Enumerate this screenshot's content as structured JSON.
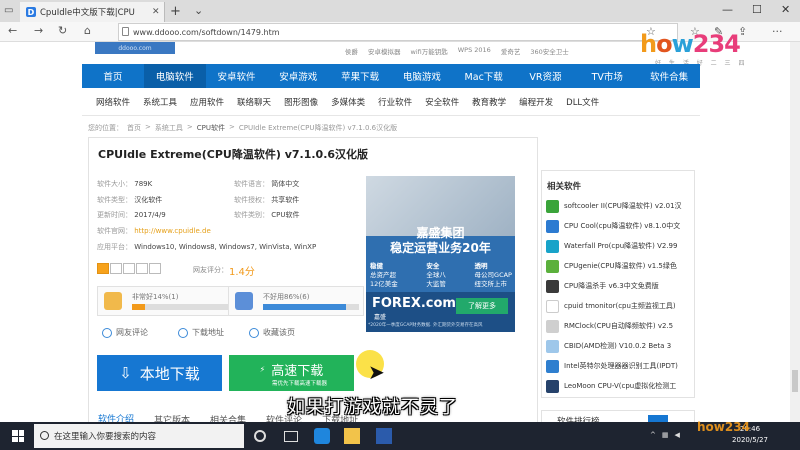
{
  "browser": {
    "tab_title": "CpuIdle中文版下载|CPU",
    "url": "www.ddooo.com/softdown/1479.htm"
  },
  "site": {
    "top_links": [
      "侯爵",
      "安卓模拟器",
      "wifi万能钥匙",
      "WPS 2016",
      "爱奇艺",
      "360安全卫士"
    ],
    "brand_chars": [
      "h",
      "o",
      "w",
      "234"
    ],
    "brand_sub": "好 生 活 好 二 三 四",
    "main_nav": [
      "首页",
      "电脑软件",
      "安卓软件",
      "安卓游戏",
      "苹果下载",
      "电脑游戏",
      "Mac下载",
      "VR资源",
      "TV市场",
      "软件合集"
    ],
    "sub_nav": [
      "网络软件",
      "系统工具",
      "应用软件",
      "联络聊天",
      "图形图像",
      "多媒体类",
      "行业软件",
      "安全软件",
      "教育教学",
      "编程开发",
      "DLL文件"
    ],
    "breadcrumb": [
      "您的位置：",
      "首页",
      ">",
      "系统工具",
      ">",
      "CPU软件",
      ">",
      "CPUIdle Extreme(CPU降温软件) v7.1.0.6汉化版"
    ]
  },
  "app": {
    "title": "CPUIdle Extreme(CPU降温软件) v7.1.0.6汉化版",
    "size_label": "软件大小：",
    "size": "789K",
    "lang_label": "软件语言：",
    "lang": "简体中文",
    "type_label": "软件类型：",
    "type": "汉化软件",
    "license_label": "软件授权：",
    "license": "共享软件",
    "updated_label": "更新时间：",
    "updated": "2017/4/9",
    "category_label": "软件类别：",
    "category": "CPU软件",
    "site_label": "软件官网：",
    "site": "http://www.cpuidle.de",
    "env_label": "应用平台：",
    "env": "Windows10, Windows8, Windows7, WinVista, WinXP",
    "rating_label": "网友评分：",
    "rating": "1.4分",
    "rating_stars": 1,
    "vote_good": "非常好14%(1)",
    "vote_good_pct": 14,
    "vote_bad": "不好用86%(6)",
    "vote_bad_pct": 86,
    "actions": [
      "网友评论",
      "下载地址",
      "收藏该页"
    ],
    "btn_local": "本地下载",
    "btn_fast": "高速下载",
    "btn_fast_sub": "需优先下载高速下载器",
    "tabs": [
      "软件介绍",
      "其它版本",
      "相关合集",
      "软件评论",
      "下载地址"
    ]
  },
  "ad": {
    "title1": "嘉盛集团",
    "title2": "稳定运营业务20年",
    "col1": [
      "稳健",
      "总资产超",
      "12亿美金"
    ],
    "col2": [
      "安全",
      "全球八",
      "大监管"
    ],
    "col3": [
      "透明",
      "母公司GCAP",
      "纽交所上市"
    ],
    "brand": "FOREX.com",
    "brand_cn": "嘉盛",
    "cta": "了解更多",
    "footer": "*2020年一季度GCAP财务数据. 外汇期货外交易存在高风"
  },
  "sidebar": {
    "head": "相关软件",
    "items": [
      {
        "label": "softcooler II(CPU降温软件) v2.01汉",
        "color": "#3aa43a"
      },
      {
        "label": "CPU Cool(cpu降温软件) v8.1.0中文",
        "color": "#2c7bd1"
      },
      {
        "label": "Waterfall Pro(cpu降温软件) V2.99",
        "color": "#18a3c9"
      },
      {
        "label": "CPUgenie(CPU降温软件) v1.5绿色",
        "color": "#5bb03c"
      },
      {
        "label": "CPU降温杀手 v6.3中文免费版",
        "color": "#3a3a3a"
      },
      {
        "label": "cpuid tmonitor(cpu主频监视工具)",
        "color": "#ffffff"
      },
      {
        "label": "RMClock(CPU自动降频软件) v2.5",
        "color": "#cfcfcf"
      },
      {
        "label": "CBID(AMD检测) V10.0.2 Beta 3",
        "color": "#9ec7ea"
      },
      {
        "label": "Intel英特尔处理器器识别工具(IPDT)",
        "color": "#2f7fcf"
      },
      {
        "label": "LeoMoon CPU-V(cpu虚拟化检测工",
        "color": "#26426b"
      }
    ],
    "rank_head": "软件排行榜"
  },
  "subtitle": "如果打游戏就不灵了",
  "taskbar": {
    "search_placeholder": "在这里输入你要搜索的内容",
    "clock_time": "20:46",
    "clock_date": "2020/5/27"
  }
}
